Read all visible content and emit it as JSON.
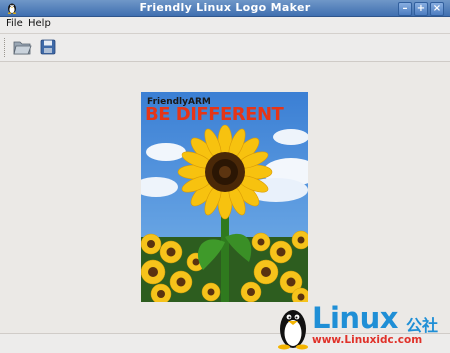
{
  "window": {
    "title": "Friendly Linux Logo Maker",
    "controls": {
      "minimize": "–",
      "maximize": "+",
      "close": "×"
    }
  },
  "menubar": {
    "items": [
      "File",
      "Help"
    ]
  },
  "toolbar": {
    "buttons": [
      "open-folder-icon",
      "save-disk-icon"
    ]
  },
  "logo": {
    "brand": "FriendlyARM",
    "slogan": "BE DIFFERENT",
    "colors": {
      "slogan": "#e63517",
      "sky": "#3f86d6",
      "petal": "#f7c20f"
    }
  },
  "watermark": {
    "text": "Linux",
    "cn": "公社",
    "url": "www.Linuxidc.com",
    "colors": {
      "text": "#1f8fd6",
      "url": "#e0322a"
    }
  }
}
